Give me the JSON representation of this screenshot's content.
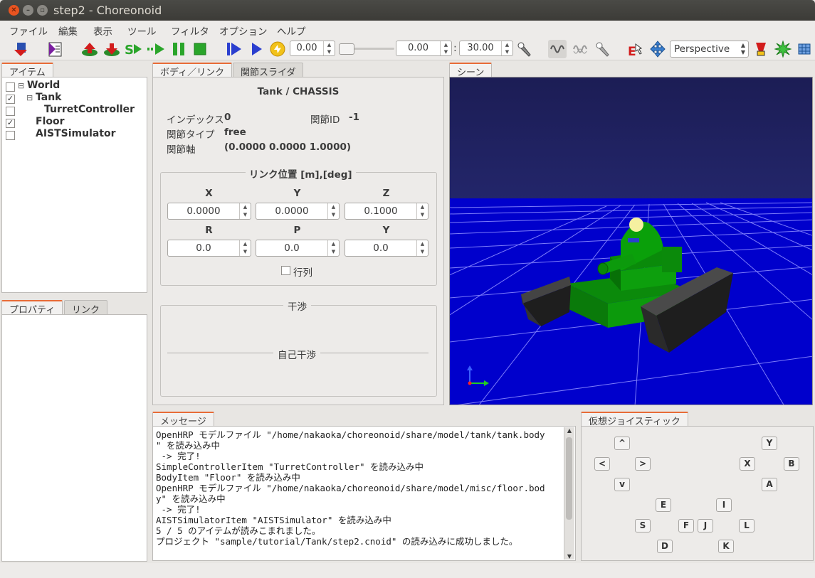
{
  "window": {
    "title": "step2 - Choreonoid"
  },
  "menu": [
    "ファイル",
    "編集",
    "表示",
    "ツール",
    "フィルタ",
    "オプション",
    "ヘルプ"
  ],
  "toolbar": {
    "time_value": "0.00",
    "start_time": "0.00",
    "end_time": "30.00",
    "colon": ":",
    "view_mode": "Perspective"
  },
  "items_panel": {
    "tab": "アイテム",
    "tree": [
      {
        "label": "World",
        "checked": false
      },
      {
        "label": "Tank",
        "checked": true
      },
      {
        "label": "TurretController",
        "checked": false
      },
      {
        "label": "Floor",
        "checked": true
      },
      {
        "label": "AISTSimulator",
        "checked": false
      }
    ]
  },
  "property_panel": {
    "tabs": [
      "プロパティ",
      "リンク"
    ]
  },
  "body_link": {
    "tabs": [
      "ボディ／リンク",
      "関節スライダ"
    ],
    "title": "Tank / CHASSIS",
    "index_label": "インデックス",
    "index_value": "0",
    "joint_id_label": "関節ID",
    "joint_id_value": "-1",
    "joint_type_label": "関節タイプ",
    "joint_type_value": "free",
    "joint_axis_label": "関節軸",
    "joint_axis_value": "(0.0000 0.0000 1.0000)",
    "link_pos_title": "リンク位置 [m],[deg]",
    "pos_labels": [
      "X",
      "Y",
      "Z"
    ],
    "pos_values": [
      "0.0000",
      "0.0000",
      "0.1000"
    ],
    "rot_labels": [
      "R",
      "P",
      "Y"
    ],
    "rot_values": [
      "0.0",
      "0.0",
      "0.0"
    ],
    "matrix_label": "行列",
    "collision_title": "干渉",
    "self_collision_title": "自己干渉"
  },
  "scene": {
    "tab": "シーン"
  },
  "messages": {
    "tab": "メッセージ",
    "lines": [
      "OpenHRP モデルファイル \"/home/nakaoka/choreonoid/share/model/tank/tank.body",
      "\" を読み込み中",
      " -> 完了!",
      "SimpleControllerItem \"TurretController\" を読み込み中",
      "BodyItem \"Floor\" を読み込み中",
      "OpenHRP モデルファイル \"/home/nakaoka/choreonoid/share/model/misc/floor.bod",
      "y\" を読み込み中",
      " -> 完了!",
      "AISTSimulatorItem \"AISTSimulator\" を読み込み中",
      "5 / 5 のアイテムが読みこまれました。",
      "プロジェクト \"sample/tutorial/Tank/step2.cnoid\" の読み込みに成功しました。"
    ]
  },
  "joystick": {
    "tab": "仮想ジョイスティック",
    "buttons": [
      "^",
      "<",
      ">",
      "v",
      "Y",
      "X",
      "B",
      "A",
      "E",
      "I",
      "S",
      "F",
      "J",
      "L",
      "D",
      "K"
    ]
  }
}
